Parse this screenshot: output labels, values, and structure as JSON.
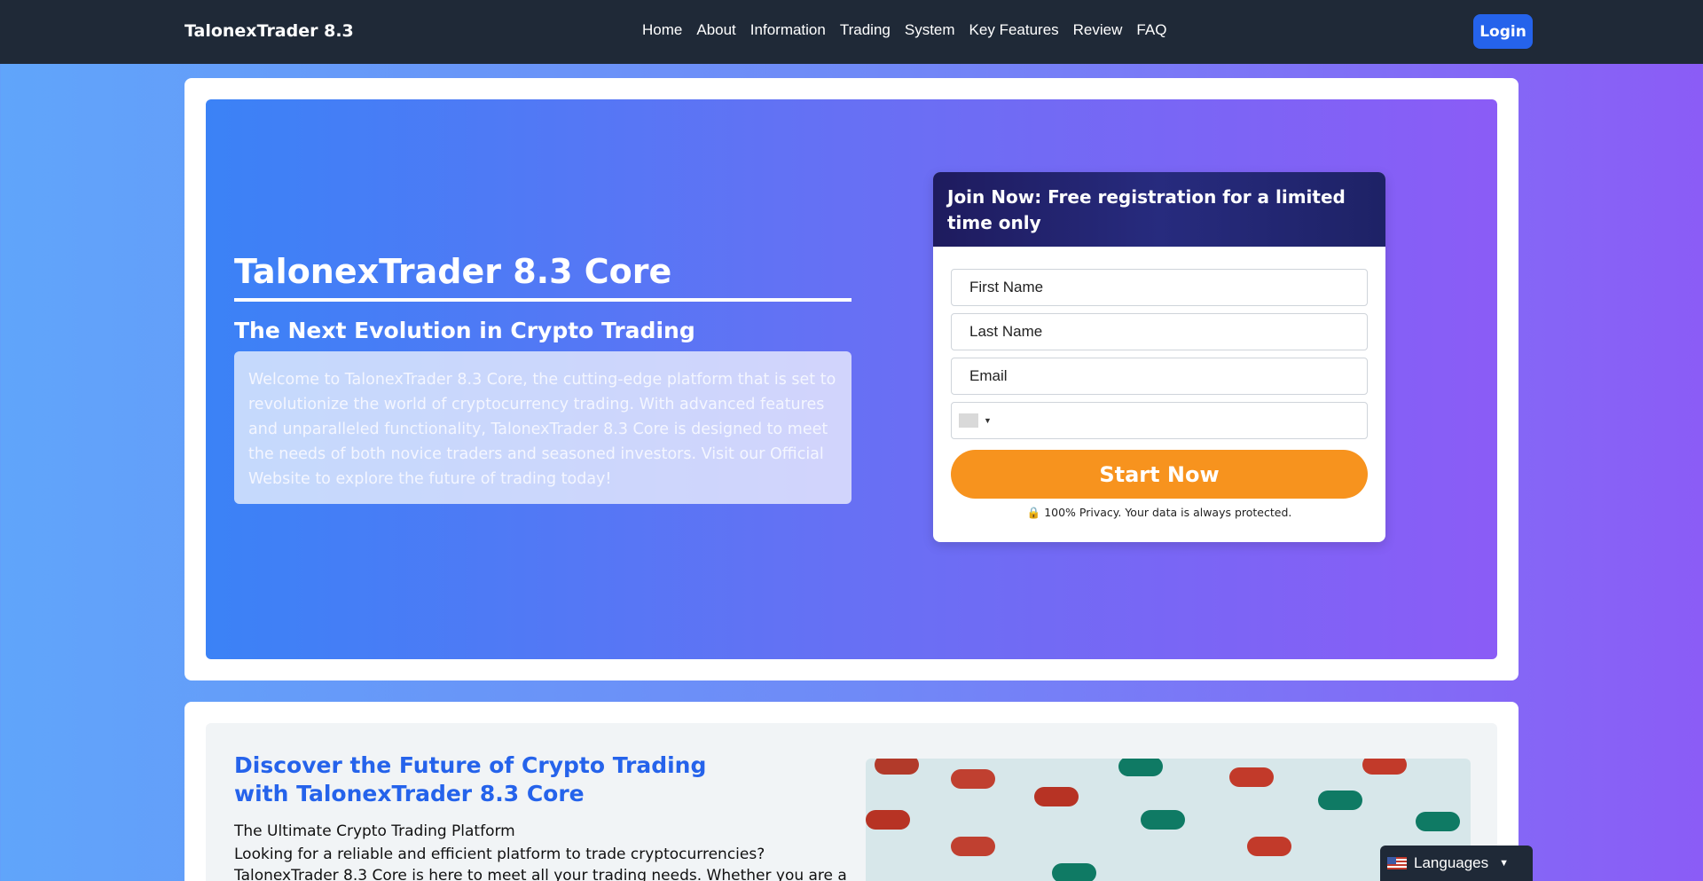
{
  "nav": {
    "brand": "TalonexTrader 8.3",
    "links": [
      "Home",
      "About",
      "Information",
      "Trading",
      "System",
      "Key Features",
      "Review",
      "FAQ"
    ],
    "login_label": "Login"
  },
  "hero": {
    "title": "TalonexTrader 8.3 Core",
    "subtitle": "The Next Evolution in Crypto Trading",
    "description": "Welcome to TalonexTrader 8.3 Core, the cutting-edge platform that is set to revolutionize the world of cryptocurrency trading. With advanced features and unparalleled functionality, TalonexTrader 8.3 Core is designed to meet the needs of both novice traders and seasoned investors. Visit our Official Website to explore the future of trading today!"
  },
  "form": {
    "heading": "Join Now: Free registration for a limited time only",
    "first_name_placeholder": "First Name",
    "last_name_placeholder": "Last Name",
    "email_placeholder": "Email",
    "phone_value": "",
    "submit_label": "Start Now",
    "privacy_text": "100% Privacy. Your data is always protected.",
    "privacy_icon": "lock-icon"
  },
  "discover": {
    "title": "Discover the Future of Crypto Trading with TalonexTrader 8.3 Core",
    "heading": "The Ultimate Crypto Trading Platform",
    "body": "Looking for a reliable and efficient platform to trade cryptocurrencies? TalonexTrader 8.3 Core is here to meet all your trading needs. Whether you are a seasoned trader or just"
  },
  "languages": {
    "label": "Languages",
    "flag_icon": "us-flag-icon"
  },
  "colors": {
    "nav_bg": "#1f2937",
    "accent_blue": "#2563eb",
    "cta_orange": "#f7931e",
    "form_header": "#1e1b5e"
  }
}
